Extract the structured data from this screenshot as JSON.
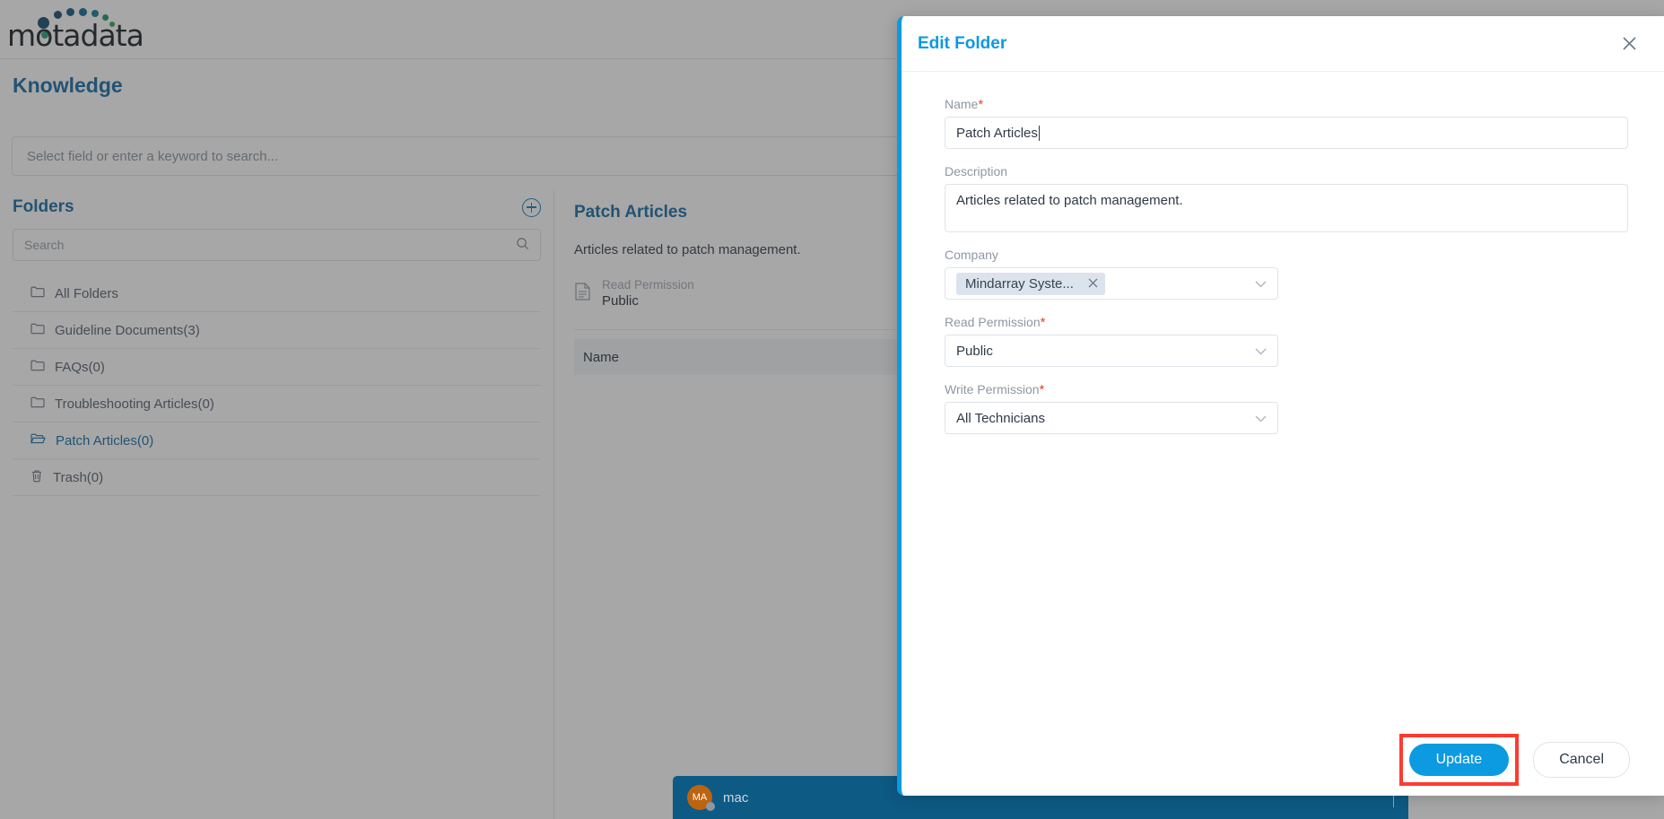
{
  "brand": {
    "logo_text": "motadata",
    "accent": "#0c9ae0",
    "link_blue": "#1b6ea8"
  },
  "topbar": {
    "action_label": "",
    "icons": [
      "circle-icon",
      "circle-icon",
      "circle-icon",
      "circle-icon",
      "circle-icon"
    ]
  },
  "page": {
    "title": "Knowledge",
    "global_search_placeholder": "Select field or enter a keyword to search..."
  },
  "folders": {
    "heading": "Folders",
    "add_icon": "plus-circle-icon",
    "search_placeholder": "Search",
    "search_icon": "search-icon",
    "items": [
      {
        "label": "All Folders",
        "icon": "folder-icon",
        "selected": false
      },
      {
        "label": "Guideline Documents(3)",
        "icon": "folder-icon",
        "selected": false
      },
      {
        "label": "FAQs(0)",
        "icon": "folder-icon",
        "selected": false
      },
      {
        "label": "Troubleshooting Articles(0)",
        "icon": "folder-icon",
        "selected": false
      },
      {
        "label": "Patch Articles(0)",
        "icon": "folder-open-icon",
        "selected": true
      },
      {
        "label": "Trash(0)",
        "icon": "trash-icon",
        "selected": false
      }
    ]
  },
  "detail": {
    "title": "Patch Articles",
    "description": "Articles related to patch management.",
    "permission_icon": "document-icon",
    "permission_label": "Read Permission",
    "permission_value": "Public",
    "table_column_name": "Name"
  },
  "chatbar": {
    "avatar_initials": "MA",
    "name": "mac",
    "status_icon": "status-dot-icon"
  },
  "modal": {
    "title": "Edit Folder",
    "close_icon": "close-icon",
    "fields": {
      "name": {
        "label": "Name",
        "required": true,
        "value": "Patch Articles",
        "placeholder": ""
      },
      "description": {
        "label": "Description",
        "required": false,
        "value": "Articles related to patch management.",
        "placeholder": ""
      },
      "company": {
        "label": "Company",
        "required": false,
        "chip_value": "Mindarray Syste...",
        "chip_remove_icon": "close-small-icon",
        "chevron_icon": "chevron-down-icon"
      },
      "read_permission": {
        "label": "Read Permission",
        "required": true,
        "value": "Public",
        "chevron_icon": "chevron-down-icon"
      },
      "write_permission": {
        "label": "Write Permission",
        "required": true,
        "value": "All Technicians",
        "chevron_icon": "chevron-down-icon"
      }
    },
    "buttons": {
      "submit_label": "Update",
      "cancel_label": "Cancel",
      "submit_highlight_color": "#ff3b30"
    }
  }
}
